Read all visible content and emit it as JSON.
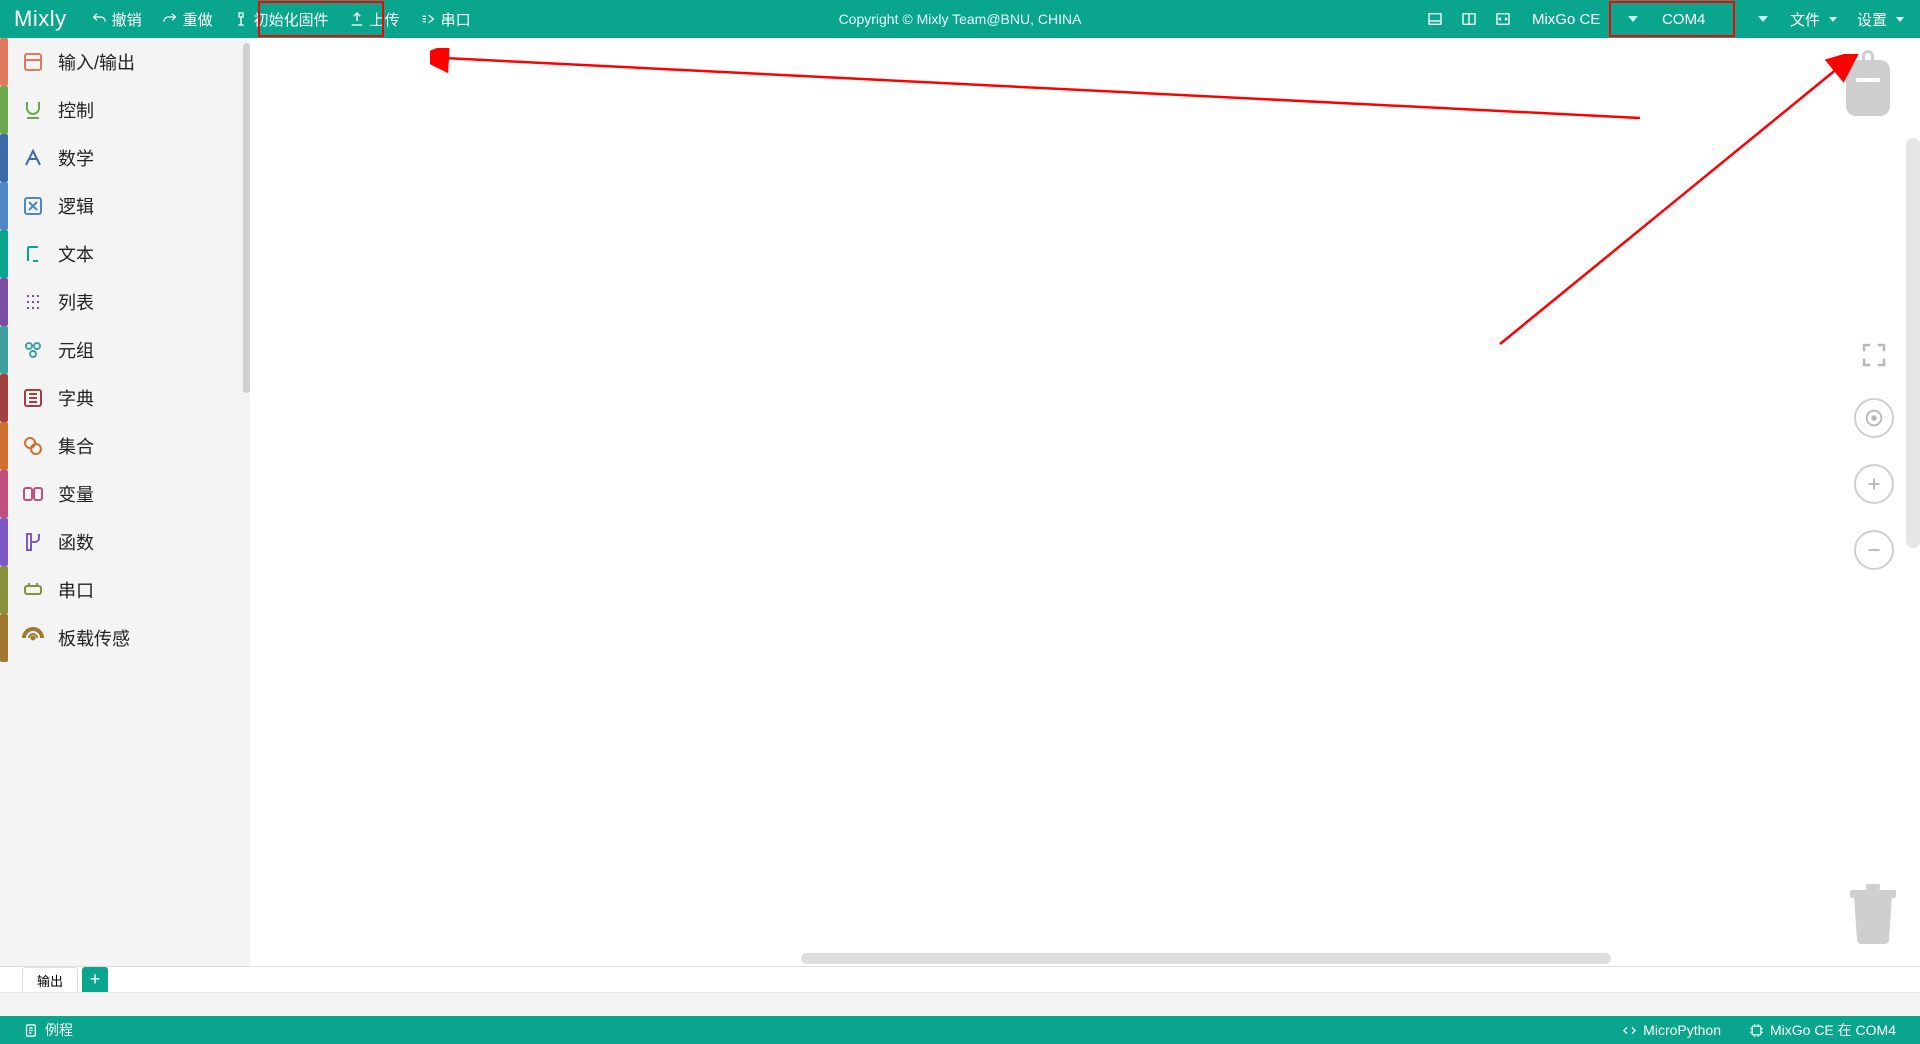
{
  "brand": "Mixly",
  "toolbar": {
    "undo": "撤销",
    "redo": "重做",
    "init_firmware": "初始化固件",
    "upload": "上传",
    "serial": "串口",
    "copyright": "Copyright © Mixly Team@BNU, CHINA",
    "board": "MixGo CE",
    "port": "COM4",
    "file": "文件",
    "settings": "设置"
  },
  "categories": [
    {
      "label": "输入/输出",
      "color": "#e07a5f"
    },
    {
      "label": "控制",
      "color": "#6aa84f"
    },
    {
      "label": "数学",
      "color": "#3c6aa6"
    },
    {
      "label": "逻辑",
      "color": "#4f86c6"
    },
    {
      "label": "文本",
      "color": "#0aa58d"
    },
    {
      "label": "列表",
      "color": "#7a4fa3"
    },
    {
      "label": "元组",
      "color": "#3fa0a0"
    },
    {
      "label": "字典",
      "color": "#a04040"
    },
    {
      "label": "集合",
      "color": "#d07030"
    },
    {
      "label": "变量",
      "color": "#c05080"
    },
    {
      "label": "函数",
      "color": "#7c5ac2"
    },
    {
      "label": "串口",
      "color": "#8a8f3a"
    },
    {
      "label": "板载传感",
      "color": "#a07830"
    }
  ],
  "tabs": {
    "output": "输出",
    "add": "+"
  },
  "footer": {
    "examples": "例程",
    "lang": "MicroPython",
    "board_at_port": "MixGo CE 在 COM4"
  }
}
